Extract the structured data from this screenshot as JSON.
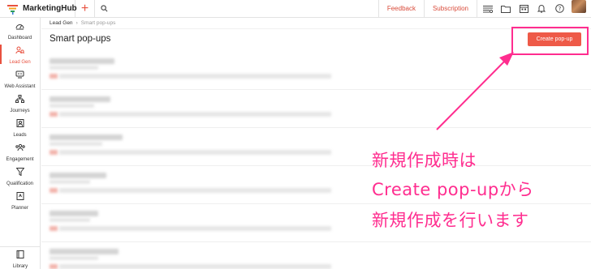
{
  "app": {
    "name": "MarketingHub"
  },
  "topbar": {
    "links": [
      "Feedback",
      "Subscription"
    ],
    "icons": [
      "add-icon",
      "search-icon",
      "list-filter-icon",
      "folder-icon",
      "calendar-icon",
      "bell-icon",
      "help-icon",
      "avatar"
    ]
  },
  "sidebar": {
    "items": [
      {
        "label": "Dashboard",
        "icon": "dashboard-icon"
      },
      {
        "label": "Lead Gen",
        "icon": "lead-gen-icon",
        "active": true
      },
      {
        "label": "Web Assistant",
        "icon": "web-assistant-icon"
      },
      {
        "label": "Journeys",
        "icon": "journeys-icon"
      },
      {
        "label": "Leads",
        "icon": "leads-icon"
      },
      {
        "label": "Engagement",
        "icon": "engagement-icon"
      },
      {
        "label": "Qualification",
        "icon": "qualification-icon"
      },
      {
        "label": "Planner",
        "icon": "planner-icon"
      }
    ],
    "bottom": {
      "label": "Library",
      "icon": "library-icon"
    }
  },
  "breadcrumb": {
    "parent": "Lead Gen",
    "current": "Smart pop-ups"
  },
  "page": {
    "title": "Smart pop-ups",
    "create_button": "Create pop-up"
  },
  "annotation": {
    "lines": [
      "新規作成時は",
      "Create pop-upから",
      "新規作成を行います"
    ],
    "color": "#ff2d8f"
  },
  "colors": {
    "accent": "#ee5a48",
    "annotation": "#ff2d8f"
  }
}
